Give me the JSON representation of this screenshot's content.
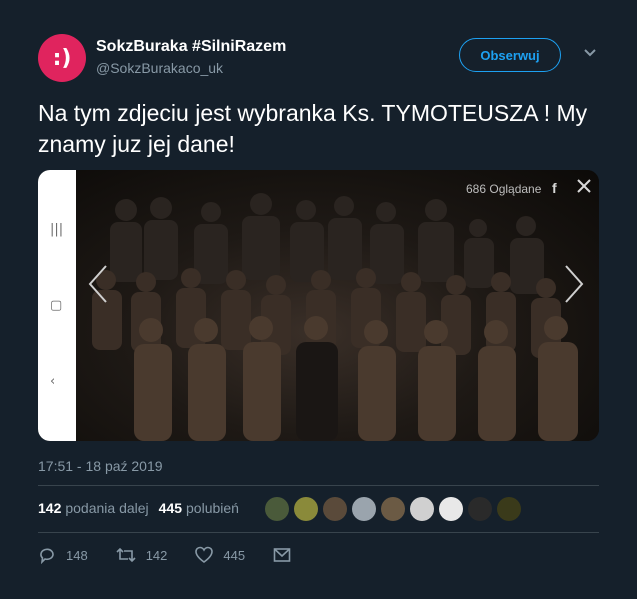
{
  "author": {
    "avatar_text": ":)",
    "name": "SokzBuraka #SilniRazem",
    "handle": "@SokzBurakaco_uk",
    "avatar_color": "#e0245e"
  },
  "follow_label": "Obserwuj",
  "tweet_text": "Na tym zdjeciu jest wybranka Ks. TYMOTEUSZA ! My znamy juz jej dane!",
  "media": {
    "views_label": "686 Oglądane",
    "facebook_glyph": "f"
  },
  "timestamp": "17:51 - 18 paź 2019",
  "stats": {
    "retweets_count": "142",
    "retweets_label": "podania dalej",
    "likes_count": "445",
    "likes_label": "polubień"
  },
  "likers": [
    "#4a5a3a",
    "#8a8a3a",
    "#5a4a3a",
    "#9aa4ad",
    "#6b5a44",
    "#d0d0d0",
    "#e8e8e8",
    "#2a2a2a",
    "#3a3a1a"
  ],
  "actions": {
    "reply_count": "148",
    "retweet_count": "142",
    "like_count": "445"
  },
  "icons": {
    "reply": "reply-icon",
    "retweet": "retweet-icon",
    "like": "heart-icon",
    "message": "envelope-icon",
    "more": "chevron-down-icon"
  },
  "colors": {
    "background": "#15202b",
    "accent": "#1da1f2",
    "muted": "#8899a6"
  }
}
